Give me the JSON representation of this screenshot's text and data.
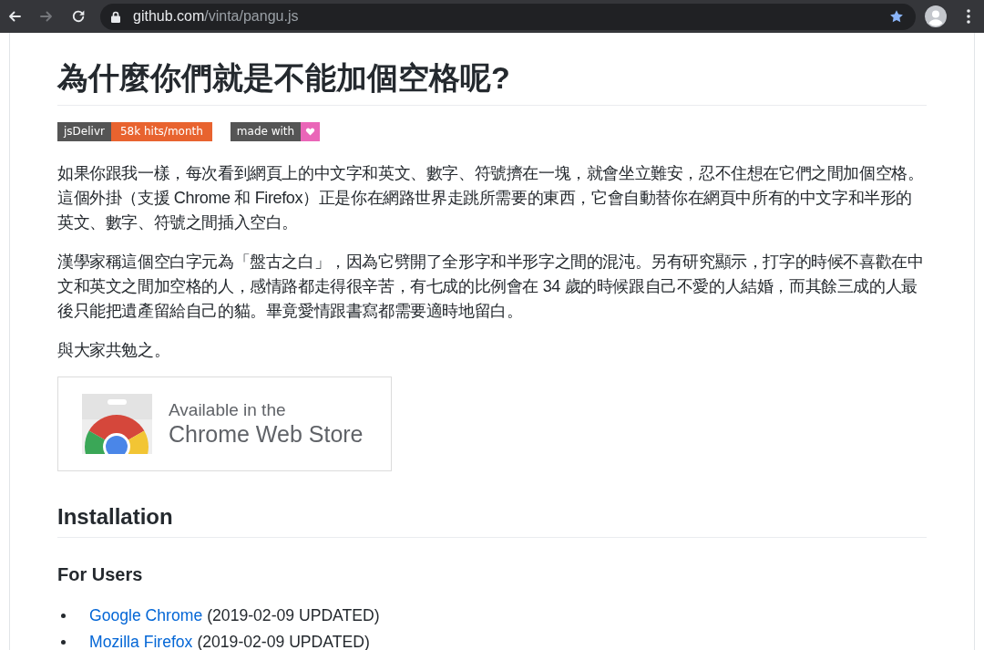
{
  "browser": {
    "nav_buttons": [
      {
        "kind": "back",
        "disabled": false
      },
      {
        "kind": "forward",
        "disabled": true
      },
      {
        "kind": "reload",
        "disabled": false
      }
    ],
    "url_host": "github.com",
    "url_path": "/vinta/pangu.js",
    "bookmarked": true
  },
  "readme": {
    "title": "為什麼你們就是不能加個空格呢?",
    "badges": [
      {
        "kind": "text",
        "label": "jsDelivr",
        "message": "58k hits/month",
        "color": "#e8632f"
      },
      {
        "kind": "heart",
        "label": "made with",
        "color": "#ea66b8"
      }
    ],
    "paragraphs": [
      "如果你跟我一樣，每次看到網頁上的中文字和英文、數字、符號擠在一塊，就會坐立難安，忍不住想在它們之間加個空格。這個外掛（支援 Chrome 和 Firefox）正是你在網路世界走跳所需要的東西，它會自動替你在網頁中所有的中文字和半形的英文、數字、符號之間插入空白。",
      "漢學家稱這個空白字元為「盤古之白」，因為它劈開了全形字和半形字之間的混沌。另有研究顯示，打字的時候不喜歡在中文和英文之間加空格的人，感情路都走得很辛苦，有七成的比例會在 34 歲的時候跟自己不愛的人結婚，而其餘三成的人最後只能把遺產留給自己的貓。畢竟愛情跟書寫都需要適時地留白。",
      "與大家共勉之。"
    ],
    "store_badge": {
      "caption": "Available in the",
      "title": "Chrome Web Store"
    },
    "sections": [
      {
        "kind": "section",
        "heading": "Installation"
      },
      {
        "kind": "subsection",
        "heading": "For Users",
        "items": [
          {
            "link": "Google Chrome",
            "note": "(2019-02-09 UPDATED)"
          },
          {
            "link": "Mozilla Firefox",
            "note": "(2019-02-09 UPDATED)"
          }
        ]
      }
    ]
  }
}
